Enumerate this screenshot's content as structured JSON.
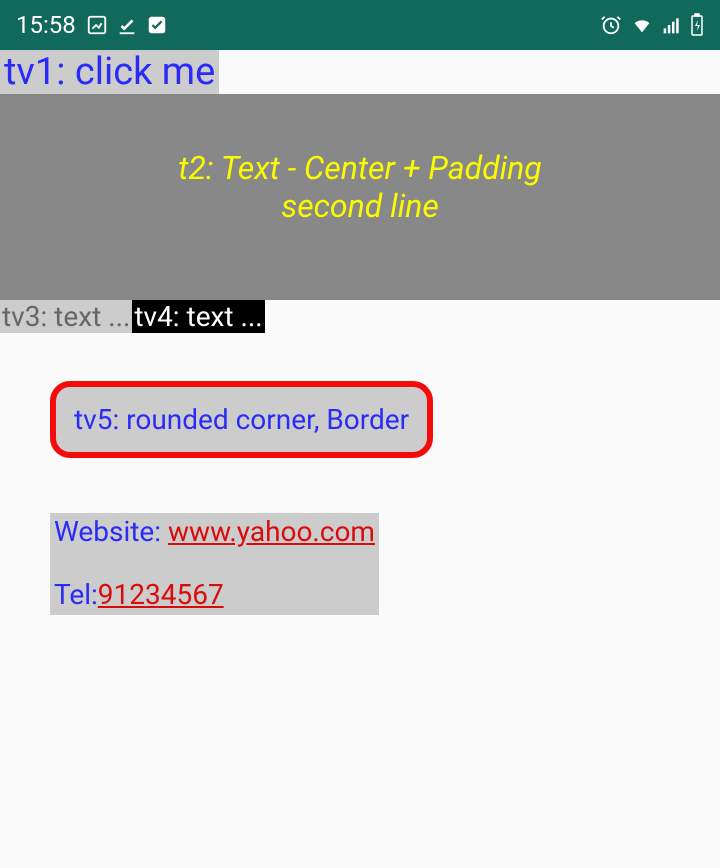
{
  "statusbar": {
    "time": "15:58"
  },
  "tv1": {
    "text": "tv1: click me"
  },
  "tv2": {
    "line1": "t2: Text - Center + Padding",
    "line2": "second line"
  },
  "tv3": {
    "text": "tv3: text ..."
  },
  "tv4": {
    "text": "tv4: text ..."
  },
  "tv5": {
    "text": "tv5: rounded corner, Border"
  },
  "tv6": {
    "website_label": "Website: ",
    "website_link": "www.yahoo.com",
    "tel_label": "Tel:",
    "tel_link": "91234567"
  }
}
